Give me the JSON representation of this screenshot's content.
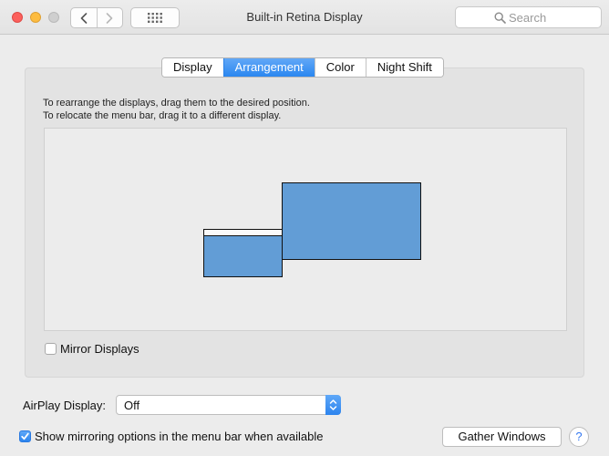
{
  "window": {
    "title": "Built-in Retina Display",
    "controls": [
      "close",
      "minimize",
      "zoom"
    ]
  },
  "toolbar": {
    "nav_back_icon": "chevron-left-icon",
    "nav_forward_icon": "chevron-right-icon",
    "show_all_icon": "grid-icon",
    "search": {
      "placeholder": "Search",
      "value": ""
    }
  },
  "tabs": [
    {
      "label": "Display",
      "active": false
    },
    {
      "label": "Arrangement",
      "active": true
    },
    {
      "label": "Color",
      "active": false
    },
    {
      "label": "Night Shift",
      "active": false
    }
  ],
  "arrangement": {
    "instruction_line1": "To rearrange the displays, drag them to the desired position.",
    "instruction_line2": "To relocate the menu bar, drag it to a different display.",
    "displays": [
      {
        "name": "built-in-display",
        "has_menu_bar": true
      },
      {
        "name": "external-display",
        "has_menu_bar": false
      }
    ],
    "mirror_displays": {
      "label": "Mirror Displays",
      "checked": false
    }
  },
  "airplay": {
    "label": "AirPlay Display:",
    "selected": "Off"
  },
  "show_mirroring": {
    "label": "Show mirroring options in the menu bar when available",
    "checked": true
  },
  "gather_windows_label": "Gather Windows",
  "help_label": "?",
  "colors": {
    "accent": "#2c84ee",
    "display_fill": "#629dd6",
    "traffic_close": "#fc605c",
    "traffic_minimize": "#fdbc40"
  }
}
